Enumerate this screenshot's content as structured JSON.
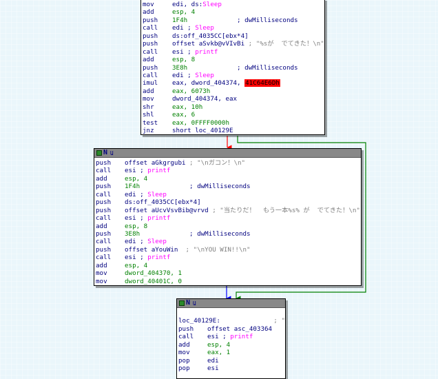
{
  "colors": {
    "background": "#eaf6fb",
    "mnemonic": "#00007f",
    "comment": "#808080",
    "function_ref": "#ff00ff",
    "number": "#008000",
    "highlight": "#ff0000",
    "edge_false": "#ff0000",
    "edge_true": "#008000",
    "edge_uncond": "#0000ff"
  },
  "node_header": {
    "title": "N",
    "mark": "Ա"
  },
  "nodes": [
    {
      "id": "block-1",
      "lines": [
        {
          "mn": "mov",
          "ops": [
            {
              "t": "edi, ds:",
              "k": "o"
            },
            {
              "t": "Sleep",
              "k": "f"
            }
          ]
        },
        {
          "mn": "add",
          "ops": [
            {
              "t": "esp, 4",
              "k": "num"
            }
          ]
        },
        {
          "mn": "push",
          "ops": [
            {
              "t": "1F4h",
              "k": "num"
            },
            {
              "t": "             ; dwMilliseconds",
              "k": "o"
            }
          ]
        },
        {
          "mn": "call",
          "ops": [
            {
              "t": "edi ; ",
              "k": "o"
            },
            {
              "t": "Sleep",
              "k": "f"
            }
          ]
        },
        {
          "mn": "push",
          "ops": [
            {
              "t": "ds:off_4035CC[ebx*4]",
              "k": "o"
            }
          ]
        },
        {
          "mn": "push",
          "ops": [
            {
              "t": "offset aSvkb@vVIvBi",
              "k": "o"
            },
            {
              "t": " ; \"%sが  でてきた！\\n\"",
              "k": "c"
            }
          ]
        },
        {
          "mn": "call",
          "ops": [
            {
              "t": "esi ; ",
              "k": "o"
            },
            {
              "t": "printf",
              "k": "f"
            }
          ]
        },
        {
          "mn": "add",
          "ops": [
            {
              "t": "esp, 8",
              "k": "num"
            }
          ]
        },
        {
          "mn": "push",
          "ops": [
            {
              "t": "3E8h",
              "k": "num"
            },
            {
              "t": "             ; dwMilliseconds",
              "k": "o"
            }
          ]
        },
        {
          "mn": "call",
          "ops": [
            {
              "t": "edi ; ",
              "k": "o"
            },
            {
              "t": "Sleep",
              "k": "f"
            }
          ]
        },
        {
          "mn": "imul",
          "ops": [
            {
              "t": "eax, dword_404374, ",
              "k": "o"
            },
            {
              "t": "41C64E6Dh",
              "k": "hl"
            }
          ]
        },
        {
          "mn": "add",
          "ops": [
            {
              "t": "eax, 6073h",
              "k": "num"
            }
          ]
        },
        {
          "mn": "mov",
          "ops": [
            {
              "t": "dword_404374, eax",
              "k": "o"
            }
          ]
        },
        {
          "mn": "shr",
          "ops": [
            {
              "t": "eax, 10h",
              "k": "num"
            }
          ]
        },
        {
          "mn": "shl",
          "ops": [
            {
              "t": "eax, 6",
              "k": "num"
            }
          ]
        },
        {
          "mn": "test",
          "ops": [
            {
              "t": "eax, 0FFFF0000h",
              "k": "num"
            }
          ]
        },
        {
          "mn": "jnz",
          "ops": [
            {
              "t": "short loc_40129E",
              "k": "o"
            }
          ]
        }
      ]
    },
    {
      "id": "block-2",
      "lines": [
        {
          "mn": "push",
          "ops": [
            {
              "t": "offset aGkgrgubi",
              "k": "o"
            },
            {
              "t": " ; \"\\nガコン！\\n\"",
              "k": "c"
            }
          ]
        },
        {
          "mn": "call",
          "ops": [
            {
              "t": "esi ; ",
              "k": "o"
            },
            {
              "t": "printf",
              "k": "f"
            }
          ]
        },
        {
          "mn": "add",
          "ops": [
            {
              "t": "esp, 4",
              "k": "num"
            }
          ]
        },
        {
          "mn": "push",
          "ops": [
            {
              "t": "1F4h",
              "k": "num"
            },
            {
              "t": "             ; dwMilliseconds",
              "k": "o"
            }
          ]
        },
        {
          "mn": "call",
          "ops": [
            {
              "t": "edi ; ",
              "k": "o"
            },
            {
              "t": "Sleep",
              "k": "f"
            }
          ]
        },
        {
          "mn": "push",
          "ops": [
            {
              "t": "ds:off_4035CC[ebx*4]",
              "k": "o"
            }
          ]
        },
        {
          "mn": "push",
          "ops": [
            {
              "t": "offset aUcvVsvBib@vrvd",
              "k": "o"
            },
            {
              "t": " ; \"当たりだ！  もう一本%s% が  でてきた！\\n\"",
              "k": "c"
            }
          ]
        },
        {
          "mn": "call",
          "ops": [
            {
              "t": "esi ; ",
              "k": "o"
            },
            {
              "t": "printf",
              "k": "f"
            }
          ]
        },
        {
          "mn": "add",
          "ops": [
            {
              "t": "esp, 8",
              "k": "num"
            }
          ]
        },
        {
          "mn": "push",
          "ops": [
            {
              "t": "3E8h",
              "k": "num"
            },
            {
              "t": "             ; dwMilliseconds",
              "k": "o"
            }
          ]
        },
        {
          "mn": "call",
          "ops": [
            {
              "t": "edi ; ",
              "k": "o"
            },
            {
              "t": "Sleep",
              "k": "f"
            }
          ]
        },
        {
          "mn": "push",
          "ops": [
            {
              "t": "offset aYouWin",
              "k": "o"
            },
            {
              "t": "  ; \"\\nYOU WIN!!\\n\"",
              "k": "c"
            }
          ]
        },
        {
          "mn": "call",
          "ops": [
            {
              "t": "esi ; ",
              "k": "o"
            },
            {
              "t": "printf",
              "k": "f"
            }
          ]
        },
        {
          "mn": "add",
          "ops": [
            {
              "t": "esp, 4",
              "k": "num"
            }
          ]
        },
        {
          "mn": "mov",
          "ops": [
            {
              "t": "dword_404370, 1",
              "k": "num"
            }
          ]
        },
        {
          "mn": "mov",
          "ops": [
            {
              "t": "dword_40401C, 0",
              "k": "num"
            }
          ]
        }
      ]
    },
    {
      "id": "block-3",
      "lines": [
        {
          "mn": "",
          "ops": []
        },
        {
          "label": "loc_40129E:",
          "ops": [
            {
              "t": "              ; \"\\n\"",
              "k": "c"
            }
          ]
        },
        {
          "mn": "push",
          "ops": [
            {
              "t": "offset asc_403364",
              "k": "o"
            }
          ]
        },
        {
          "mn": "call",
          "ops": [
            {
              "t": "esi ; ",
              "k": "o"
            },
            {
              "t": "printf",
              "k": "f"
            }
          ]
        },
        {
          "mn": "add",
          "ops": [
            {
              "t": "esp, 4",
              "k": "num"
            }
          ]
        },
        {
          "mn": "mov",
          "ops": [
            {
              "t": "eax, 1",
              "k": "num"
            }
          ]
        },
        {
          "mn": "pop",
          "ops": [
            {
              "t": "edi",
              "k": "o"
            }
          ]
        },
        {
          "mn": "pop",
          "ops": [
            {
              "t": "esi",
              "k": "o"
            }
          ]
        }
      ]
    }
  ]
}
